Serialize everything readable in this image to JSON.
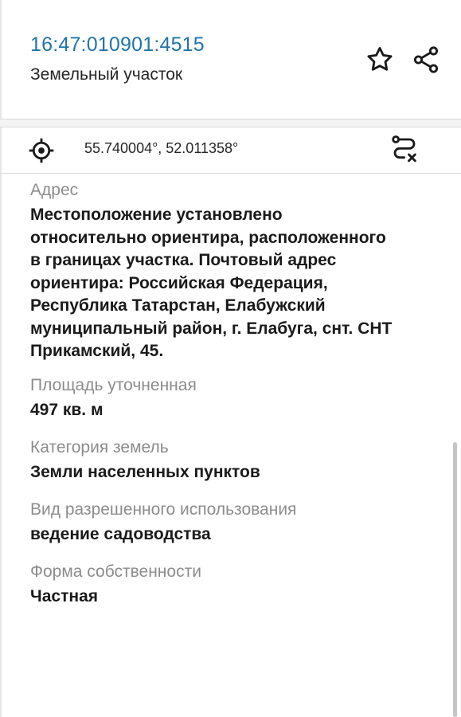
{
  "header": {
    "cadastral_number": "16:47:010901:4515",
    "object_type": "Земельный участок",
    "favorite_icon": "star-icon",
    "share_icon": "share-icon",
    "accent_color": "#1f74a8"
  },
  "location": {
    "coordinates": "55.740004°, 52.011358°",
    "locate_icon": "crosshair-icon",
    "route_icon": "route-icon"
  },
  "details": {
    "address": {
      "label": "Адрес",
      "lines": [
        "Местоположение установлено",
        "относительно ориентира, расположенного",
        "в границах участка. Почтовый адрес",
        "ориентира: Российская Федерация,",
        "Республика Татарстан, Елабужский",
        "муниципальный район, г. Елабуга, снт. СНТ",
        "Прикамский, 45."
      ]
    },
    "area": {
      "label": "Площадь уточненная",
      "value": "497 кв. м"
    },
    "land_category": {
      "label": "Категория земель",
      "value": "Земли населенных пунктов"
    },
    "permitted_use": {
      "label": "Вид разрешенного использования",
      "value": "ведение садоводства"
    },
    "ownership": {
      "label": "Форма собственности",
      "value": "Частная"
    }
  }
}
